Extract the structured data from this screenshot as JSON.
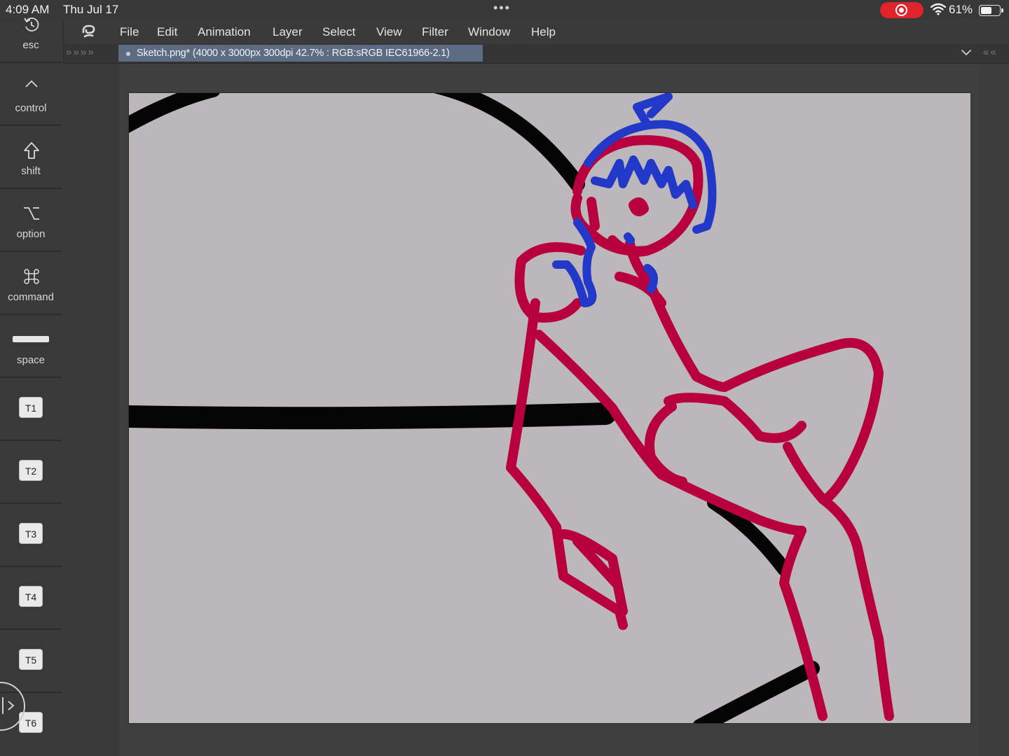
{
  "status_bar": {
    "time": "4:09 AM",
    "date": "Thu Jul 17",
    "dots": "•••",
    "battery_percent": "61%",
    "battery_level": 0.61
  },
  "menu": {
    "items": [
      "File",
      "Edit",
      "Animation",
      "Layer",
      "Select",
      "View",
      "Filter",
      "Window",
      "Help"
    ]
  },
  "tab": {
    "title": "Sketch.png* (4000 x 3000px 300dpi 42.7% : RGB:sRGB IEC61966-2.1)",
    "left_chevrons": "» » » »",
    "right_chevrons": "« «"
  },
  "keys": {
    "esc": "esc",
    "control": "control",
    "shift": "shift",
    "option": "option",
    "command": "command",
    "space": "space",
    "t_keys": [
      "T1",
      "T2",
      "T3",
      "T4",
      "T5",
      "T6"
    ]
  },
  "colors": {
    "stroke_red": "#b8003f",
    "stroke_blue": "#2238c8",
    "stroke_black": "#050505",
    "canvas_bg": "#bcb7ba",
    "tab_active": "#5d6b82",
    "record": "#e0242b"
  },
  "icons": {
    "esc": "undo-icon",
    "control": "caret-up-icon",
    "shift": "shift-arrow-icon",
    "option": "option-icon",
    "command": "command-icon",
    "app": "clip-studio-logo-icon"
  }
}
